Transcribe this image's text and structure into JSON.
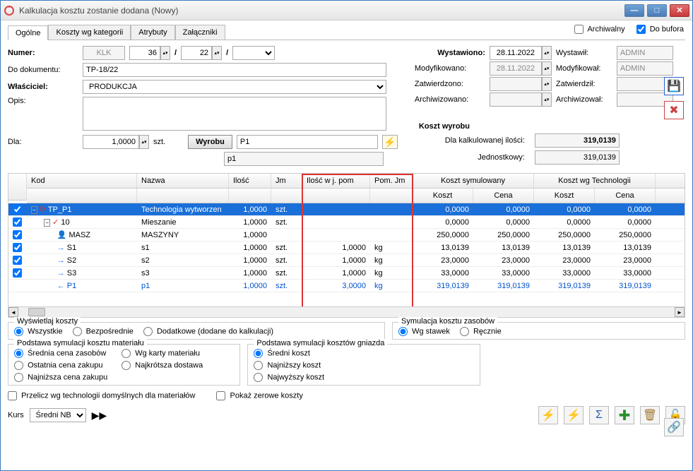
{
  "window": {
    "title": "Kalkulacja kosztu zostanie dodana  (Nowy)"
  },
  "tabs": {
    "ogolne": "Ogólne",
    "kategorie": "Koszty wg kategorii",
    "atrybuty": "Atrybuty",
    "zalaczniki": "Załączniki"
  },
  "checks": {
    "archiwalny": "Archiwalny",
    "dobufora": "Do bufora"
  },
  "form": {
    "numer_label": "Numer:",
    "numer_prefix": "KLK",
    "numer_a": "36",
    "numer_b": "22",
    "dodok_label": "Do dokumentu:",
    "dodok_val": "TP-18/22",
    "wlasciciel_label": "Właściciel:",
    "wlasciciel_val": "PRODUKCJA",
    "opis_label": "Opis:",
    "dla_label": "Dla:",
    "dla_val": "1,0000",
    "dla_jm": "szt.",
    "wyrobu_btn": "Wyrobu",
    "wyrobu_val": "P1",
    "p1": "p1"
  },
  "dates": {
    "wystawiono_label": "Wystawiono:",
    "wystawiono_val": "28.11.2022",
    "wystawil_label": "Wystawił:",
    "wystawil_val": "ADMIN",
    "modyfikowano_label": "Modyfikowano:",
    "modyfikowano_val": "28.11.2022",
    "modyfikowal_label": "Modyfikował:",
    "modyfikowal_val": "ADMIN",
    "zatwierdzono_label": "Zatwierdzono:",
    "zatwierdzil_label": "Zatwierdził:",
    "archiwizowano_label": "Archiwizowano:",
    "archiwizowal_label": "Archiwizował:"
  },
  "koszt_wyrobu": {
    "title": "Koszt wyrobu",
    "kalkulowana_label": "Dla kalkulowanej ilości:",
    "kalkulowana_val": "319,0139",
    "jednostkowy_label": "Jednostkowy:",
    "jednostkowy_val": "319,0139"
  },
  "grid": {
    "headers": {
      "kod": "Kod",
      "nazwa": "Nazwa",
      "ilosc": "Ilość",
      "jm": "Jm",
      "iloscpom": "Ilość w j. pom",
      "pomjm": "Pom. Jm",
      "symulowany": "Koszt symulowany",
      "technologii": "Koszt wg Technologii",
      "koszt": "Koszt",
      "cena": "Cena"
    },
    "rows": [
      {
        "check": true,
        "indent": 0,
        "icon": "⟳",
        "kod": "TP_P1",
        "nazwa": "Technologia wytworzen",
        "ilosc": "1,0000",
        "jm": "szt.",
        "iloscpom": "",
        "pomjm": "",
        "k1": "0,0000",
        "c1": "0,0000",
        "k2": "0,0000",
        "c2": "0,0000",
        "selected": true
      },
      {
        "check": true,
        "indent": 1,
        "icon": "✓",
        "kod": "10",
        "nazwa": "Mieszanie",
        "ilosc": "1,0000",
        "jm": "szt.",
        "iloscpom": "",
        "pomjm": "",
        "k1": "0,0000",
        "c1": "0,0000",
        "k2": "0,0000",
        "c2": "0,0000"
      },
      {
        "check": true,
        "indent": 2,
        "icon": "👤",
        "kod": "MASZ",
        "nazwa": "MASZYNY",
        "ilosc": "1,0000",
        "jm": "",
        "iloscpom": "",
        "pomjm": "",
        "k1": "250,0000",
        "c1": "250,0000",
        "k2": "250,0000",
        "c2": "250,0000"
      },
      {
        "check": true,
        "indent": 2,
        "icon": "→",
        "kod": "S1",
        "nazwa": "s1",
        "ilosc": "1,0000",
        "jm": "szt.",
        "iloscpom": "1,0000",
        "pomjm": "kg",
        "k1": "13,0139",
        "c1": "13,0139",
        "k2": "13,0139",
        "c2": "13,0139"
      },
      {
        "check": true,
        "indent": 2,
        "icon": "→",
        "kod": "S2",
        "nazwa": "s2",
        "ilosc": "1,0000",
        "jm": "szt.",
        "iloscpom": "1,0000",
        "pomjm": "kg",
        "k1": "23,0000",
        "c1": "23,0000",
        "k2": "23,0000",
        "c2": "23,0000"
      },
      {
        "check": true,
        "indent": 2,
        "icon": "→",
        "kod": "S3",
        "nazwa": "s3",
        "ilosc": "1,0000",
        "jm": "szt.",
        "iloscpom": "1,0000",
        "pomjm": "kg",
        "k1": "33,0000",
        "c1": "33,0000",
        "k2": "33,0000",
        "c2": "33,0000"
      },
      {
        "check": false,
        "indent": 2,
        "icon": "←",
        "kod": "P1",
        "nazwa": "p1",
        "ilosc": "1,0000",
        "jm": "szt.",
        "iloscpom": "3,0000",
        "pomjm": "kg",
        "k1": "319,0139",
        "c1": "319,0139",
        "k2": "319,0139",
        "c2": "319,0139",
        "blue": true
      }
    ]
  },
  "radios": {
    "wyswietlaj_title": "Wyświetlaj koszty",
    "wszystkie": "Wszystkie",
    "bezposrednie": "Bezpośrednie",
    "dodatkowe": "Dodatkowe (dodane do kalkulacji)",
    "symulacja_title": "Symulacja kosztu zasobów",
    "wgstawek": "Wg stawek",
    "recznie": "Ręcznie",
    "material_title": "Podstawa symulacji kosztu materiału",
    "srednia": "Średnia cena zasobów",
    "wgkarty": "Wg karty materiału",
    "ostatnia": "Ostatnia cena zakupu",
    "najkrotsza": "Najkrótsza dostawa",
    "najnizsza": "Najniższa cena zakupu",
    "gniazda_title": "Podstawa symulacji kosztów gniazda",
    "sredni": "Średni koszt",
    "najnizszy": "Najniższy koszt",
    "najwyzszy": "Najwyższy koszt"
  },
  "bottom": {
    "przelicz": "Przelicz wg technologii domyślnych dla materiałów",
    "pokaz_zerowe": "Pokaż zerowe koszty",
    "kurs_label": "Kurs",
    "kurs_val": "Średni NBP"
  }
}
